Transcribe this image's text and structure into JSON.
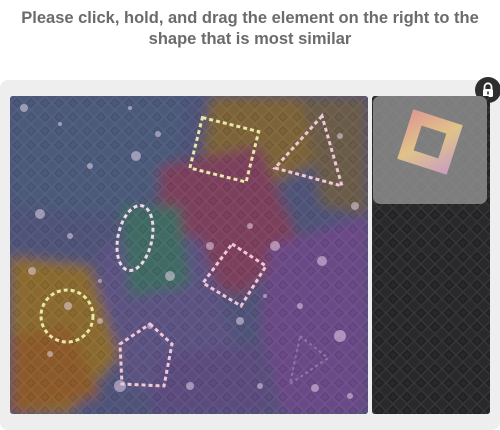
{
  "instruction": {
    "line1": "Please click, hold, and drag the element on the right to the",
    "line2": "shape that is most similar"
  },
  "lock_icon": "lock-icon",
  "piece": {
    "shape": "square-ring",
    "colors": [
      "#e79a93",
      "#e8c98a",
      "#cfa0c8"
    ]
  },
  "target_shapes": [
    "square",
    "triangle",
    "oval",
    "diamond",
    "circle",
    "pentagon",
    "triangle-faint"
  ],
  "colors": {
    "dotted_light": "#e8e8a8",
    "dotted_pink": "#f0c8d8",
    "frame_bg": "#eeeeee"
  }
}
